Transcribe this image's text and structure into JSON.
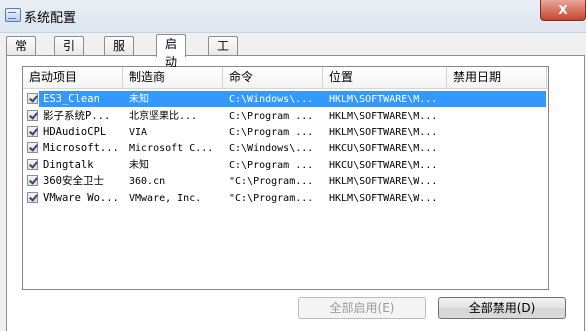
{
  "window": {
    "title": "系统配置",
    "close_label": "X"
  },
  "tabs": [
    {
      "label": "常规",
      "active": false
    },
    {
      "label": "引导",
      "active": false
    },
    {
      "label": "服务",
      "active": false
    },
    {
      "label": "启动",
      "active": true
    },
    {
      "label": "工具",
      "active": false
    }
  ],
  "table": {
    "headers": [
      "启动项目",
      "制造商",
      "命令",
      "位置",
      "禁用日期"
    ],
    "rows": [
      {
        "checked": true,
        "selected": true,
        "item": "ES3_Clean",
        "maker": "未知",
        "command": "C:\\Windows\\...",
        "location": "HKLM\\SOFTWARE\\M..."
      },
      {
        "checked": true,
        "selected": false,
        "item": "影子系统P...",
        "maker": "北京坚果比...",
        "command": "C:\\Program ...",
        "location": "HKLM\\SOFTWARE\\M..."
      },
      {
        "checked": true,
        "selected": false,
        "item": "HDAudioCPL",
        "maker": "VIA",
        "command": "C:\\Program ...",
        "location": "HKLM\\SOFTWARE\\M..."
      },
      {
        "checked": true,
        "selected": false,
        "item": "Microsoft...",
        "maker": "Microsoft C...",
        "command": "C:\\Windows\\...",
        "location": "HKCU\\SOFTWARE\\M..."
      },
      {
        "checked": true,
        "selected": false,
        "item": "Dingtalk",
        "maker": "未知",
        "command": "C:\\Program ...",
        "location": "HKCU\\SOFTWARE\\M..."
      },
      {
        "checked": true,
        "selected": false,
        "item": "360安全卫士",
        "maker": "360.cn",
        "command": "\"C:\\Program...",
        "location": "HKLM\\SOFTWARE\\W..."
      },
      {
        "checked": true,
        "selected": false,
        "item": "VMware Wo...",
        "maker": "VMware, Inc.",
        "command": "\"C:\\Program...",
        "location": "HKLM\\SOFTWARE\\W..."
      }
    ]
  },
  "buttons": {
    "enable_all": "全部启用(E)",
    "disable_all": "全部禁用(D)"
  }
}
